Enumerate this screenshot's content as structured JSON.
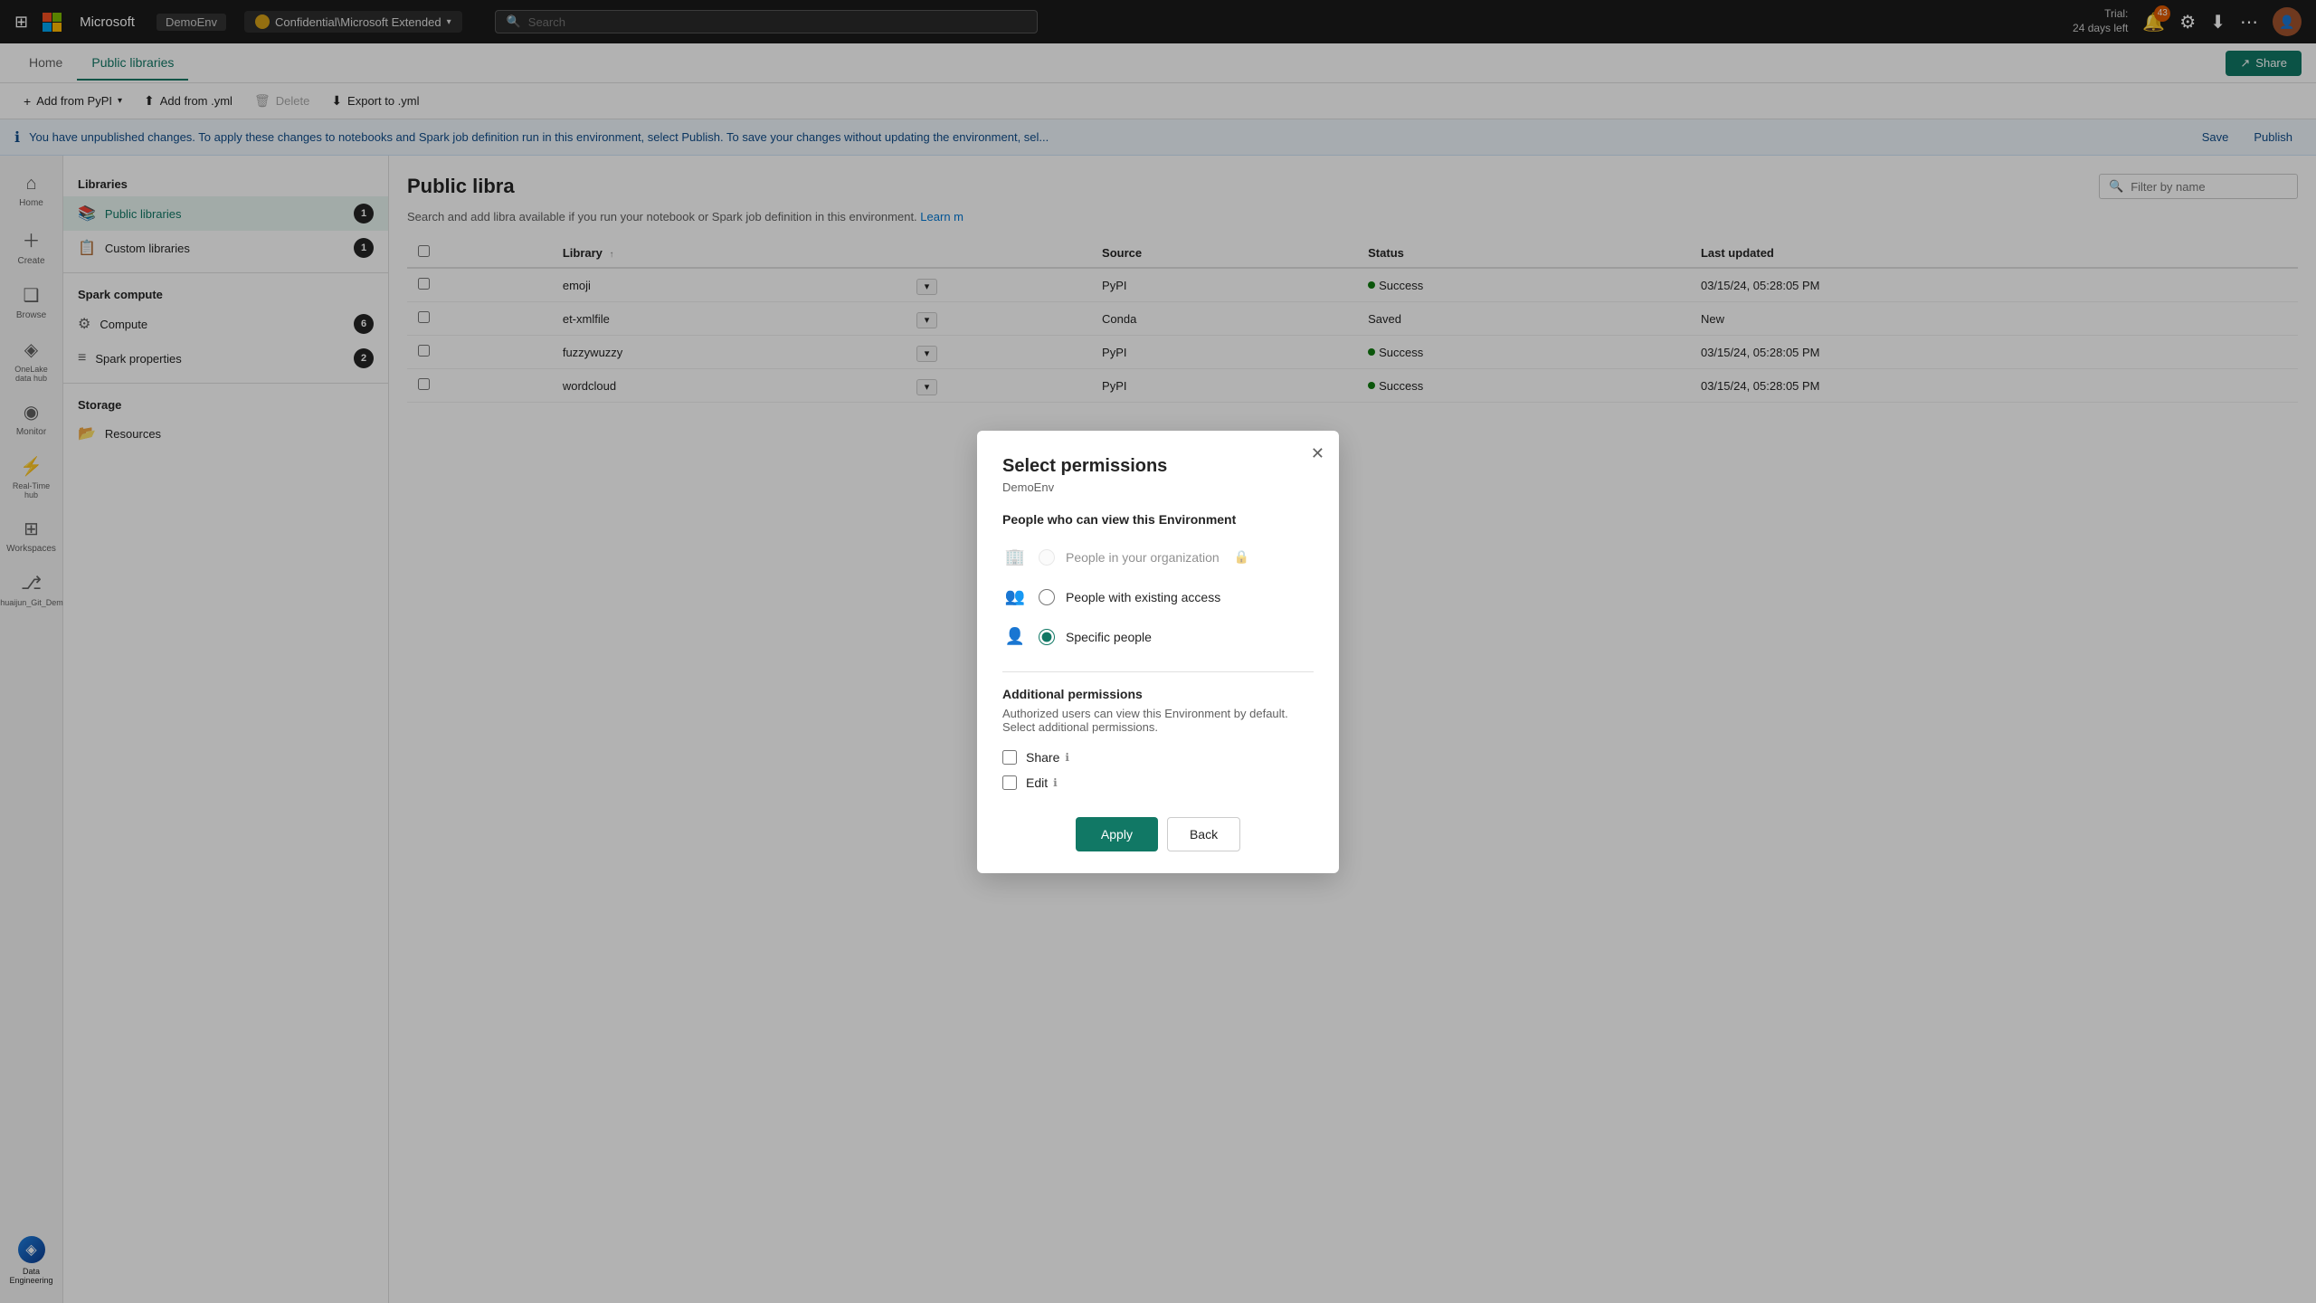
{
  "topbar": {
    "app_name": "Microsoft",
    "env_name": "DemoEnv",
    "workspace_label": "Confidential\\Microsoft Extended",
    "search_placeholder": "Search",
    "trial_label": "Trial:",
    "trial_days": "24 days left",
    "notif_count": "43",
    "share_label": "Share"
  },
  "nav": {
    "tab_home": "Home",
    "tab_public_libraries": "Public libraries"
  },
  "toolbar": {
    "add_pypi": "Add from PyPI",
    "add_yml": "Add from .yml",
    "delete": "Delete",
    "export_yml": "Export to .yml"
  },
  "notification_bar": {
    "text": "You have unpublished changes. To apply these changes to notebooks and Spark job definition run in this environment, select Publish. To save your changes without updating the environment, sel...",
    "save_label": "Save",
    "publish_label": "Publish"
  },
  "sidebar": {
    "items": [
      {
        "label": "Home",
        "icon": "⌂"
      },
      {
        "label": "Create",
        "icon": "+"
      },
      {
        "label": "Browse",
        "icon": "❑"
      },
      {
        "label": "OneLake data hub",
        "icon": "◈"
      },
      {
        "label": "Monitor",
        "icon": "◉"
      },
      {
        "label": "Real-Time hub",
        "icon": "⚡"
      },
      {
        "label": "Workspaces",
        "icon": "⊞"
      },
      {
        "label": "Shuaijun_Git_Demo",
        "icon": "⎇"
      }
    ],
    "bottom_label": "DemoEnv",
    "data_eng_label": "Data Engineering"
  },
  "libraries_panel": {
    "section_title": "Libraries",
    "items": [
      {
        "name": "Public libraries",
        "badge": "1",
        "active": true
      },
      {
        "name": "Custom libraries",
        "badge": "1",
        "active": false
      }
    ],
    "spark_section": "Spark compute",
    "spark_items": [
      {
        "name": "Compute",
        "badge": "6"
      },
      {
        "name": "Spark properties",
        "badge": "2"
      }
    ],
    "storage_section": "Storage",
    "storage_items": [
      {
        "name": "Resources",
        "badge": ""
      }
    ]
  },
  "table": {
    "title": "Public libra",
    "description": "Search and add libra                                          available if you run your notebook or Spark job definition in this environment.",
    "learn_more": "Learn m",
    "filter_placeholder": "Filter by name",
    "columns": [
      "Library",
      "Source",
      "Status",
      "Last updated"
    ],
    "rows": [
      {
        "name": "emoji",
        "source": "PyPI",
        "status": "Success",
        "last_updated": "03/15/24, 05:28:05 PM"
      },
      {
        "name": "et-xmlfile",
        "source": "Conda",
        "status": "Saved",
        "last_updated": "New"
      },
      {
        "name": "fuzzywuzzy",
        "source": "PyPI",
        "status": "Success",
        "last_updated": "03/15/24, 05:28:05 PM"
      },
      {
        "name": "wordcloud",
        "source": "PyPI",
        "status": "Success",
        "last_updated": "03/15/24, 05:28:05 PM"
      }
    ]
  },
  "dialog": {
    "title": "Select permissions",
    "subtitle": "DemoEnv",
    "close_icon": "✕",
    "view_section_label": "People who can view this Environment",
    "radio_options": [
      {
        "id": "org",
        "label": "People in your organization",
        "disabled": true,
        "checked": false
      },
      {
        "id": "existing",
        "label": "People with existing access",
        "disabled": false,
        "checked": false
      },
      {
        "id": "specific",
        "label": "Specific people",
        "disabled": false,
        "checked": true
      }
    ],
    "additional_title": "Additional permissions",
    "additional_desc": "Authorized users can view this Environment by default. Select additional permissions.",
    "checkboxes": [
      {
        "id": "share",
        "label": "Share",
        "checked": false
      },
      {
        "id": "edit",
        "label": "Edit",
        "checked": false
      }
    ],
    "apply_label": "Apply",
    "back_label": "Back"
  }
}
